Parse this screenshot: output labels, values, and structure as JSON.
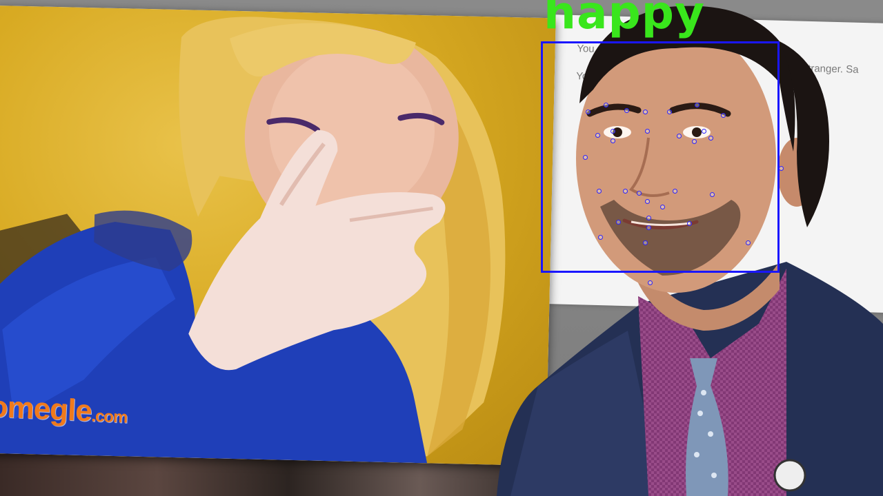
{
  "background_chat": {
    "line1": "You",
    "line2": "You",
    "line3": "stranger. Sa"
  },
  "webcam": {
    "logo_main": "omegle",
    "logo_tld": ".com"
  },
  "detection": {
    "emotion_label": "happy",
    "box_color": "#1a16ff",
    "label_color": "#39e61c",
    "landmark_count": 32
  },
  "colors": {
    "omegle_orange": "#f07a1c",
    "background_gray": "#8a8a8a"
  }
}
